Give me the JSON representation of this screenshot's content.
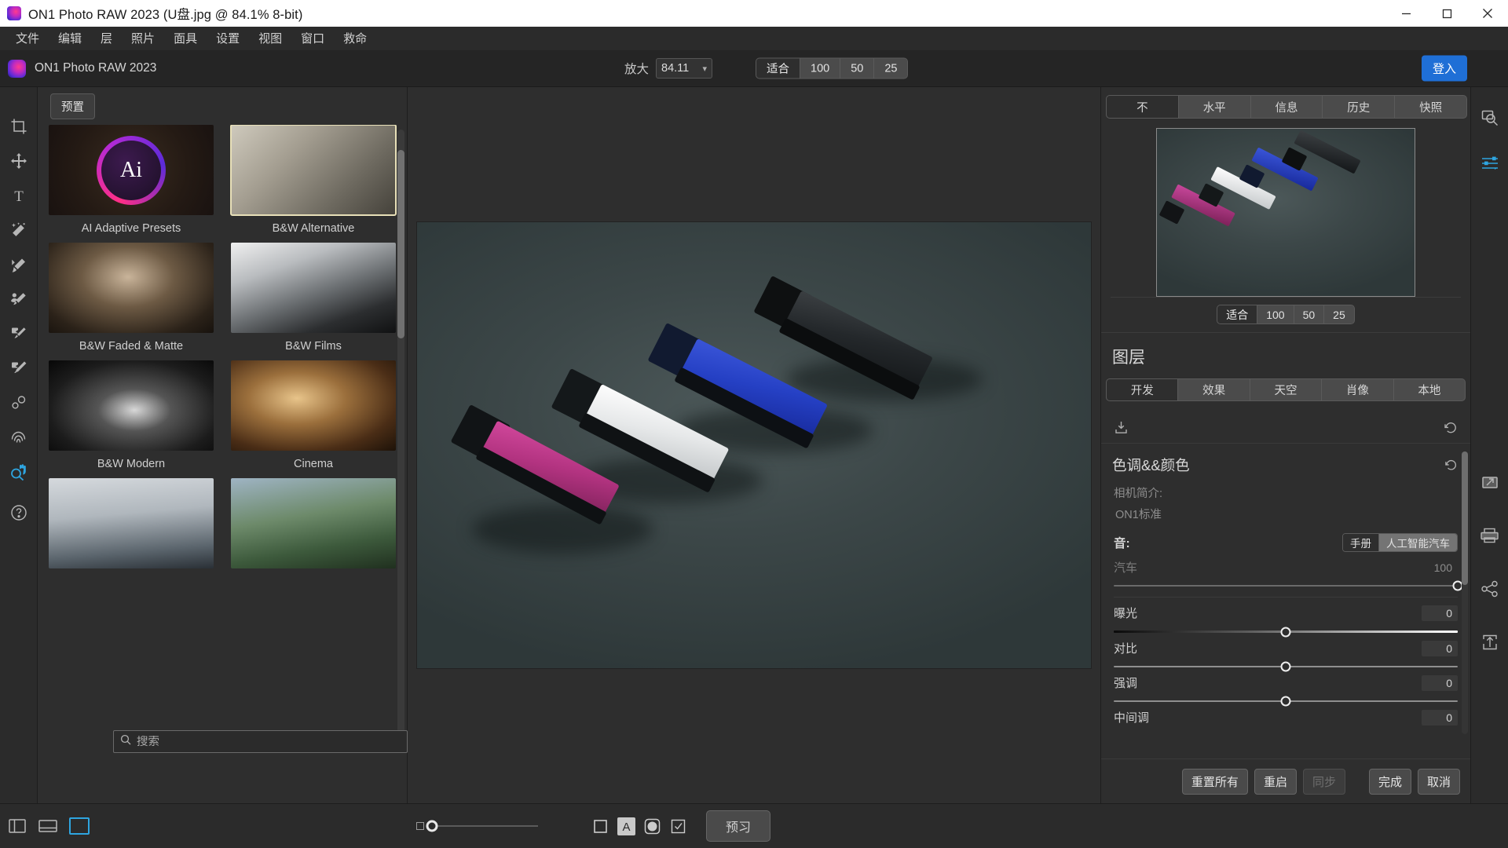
{
  "window": {
    "title": "ON1 Photo RAW 2023 (U盘.jpg @ 84.1% 8-bit)",
    "app_icon": "on1-logo-icon",
    "minimize_label": "minimize",
    "maximize_label": "maximize",
    "close_label": "close"
  },
  "menubar": {
    "items": [
      {
        "label": "文件"
      },
      {
        "label": "编辑"
      },
      {
        "label": "层"
      },
      {
        "label": "照片"
      },
      {
        "label": "面具"
      },
      {
        "label": "设置"
      },
      {
        "label": "视图"
      },
      {
        "label": "窗口"
      },
      {
        "label": "救命"
      }
    ]
  },
  "header": {
    "brand": "ON1 Photo RAW 2023",
    "zoom_label": "放大",
    "zoom_value": "84.11",
    "zoom_chevron": "chevron-down-icon",
    "fit_options": [
      {
        "label": "适合",
        "selected": true
      },
      {
        "label": "100",
        "selected": false
      },
      {
        "label": "50",
        "selected": false
      },
      {
        "label": "25",
        "selected": false
      }
    ],
    "login_label": "登入"
  },
  "tool_rail": {
    "tools": [
      {
        "name": "crop-tool",
        "active": false
      },
      {
        "name": "move-tool",
        "active": false
      },
      {
        "name": "text-tool",
        "active": false
      },
      {
        "name": "magic-wand-tool",
        "active": false
      },
      {
        "name": "retouch-brush-tool",
        "active": false
      },
      {
        "name": "portrait-brush-tool",
        "active": false
      },
      {
        "name": "perfect-eraser-tool",
        "active": false
      },
      {
        "name": "clone-stamp-tool",
        "active": false
      },
      {
        "name": "blemish-remover-tool",
        "active": false
      },
      {
        "name": "fingerprint-tool",
        "active": false
      },
      {
        "name": "zoom-hand-tool",
        "active": true
      },
      {
        "name": "help-tool",
        "active": false
      }
    ]
  },
  "presets": {
    "tab_label": "预置",
    "search_placeholder": "搜索",
    "search_value": "",
    "search_icon": "search-icon",
    "items": [
      {
        "label": "AI Adaptive Presets",
        "selected": false,
        "thumb": "ai-adaptive"
      },
      {
        "label": "B&W Alternative",
        "selected": true,
        "thumb": "bw-architecture"
      },
      {
        "label": "B&W Faded & Matte",
        "selected": false,
        "thumb": "bw-portrait"
      },
      {
        "label": "B&W Films",
        "selected": false,
        "thumb": "bw-bridge"
      },
      {
        "label": "B&W Modern",
        "selected": false,
        "thumb": "bw-waterfall"
      },
      {
        "label": "Cinema",
        "selected": false,
        "thumb": "cinema-woman"
      },
      {
        "label": "",
        "selected": false,
        "thumb": "still-life-scale"
      },
      {
        "label": "",
        "selected": false,
        "thumb": "landscape-woman"
      }
    ]
  },
  "canvas": {
    "image_name": "U盘.jpg",
    "image_alt": "四个 USB 闪存盘 (洋红、白、蓝、黑) 置于深灰绿色背景上"
  },
  "right_panel": {
    "tabs": [
      {
        "label": "不",
        "selected": true
      },
      {
        "label": "水平",
        "selected": false
      },
      {
        "label": "信息",
        "selected": false
      },
      {
        "label": "历史",
        "selected": false
      },
      {
        "label": "快照",
        "selected": false
      }
    ],
    "preview_fit_options": [
      {
        "label": "适合",
        "selected": true
      },
      {
        "label": "100",
        "selected": false
      },
      {
        "label": "50",
        "selected": false
      },
      {
        "label": "25",
        "selected": false
      }
    ],
    "layers_title": "图层",
    "layer_tabs": [
      {
        "label": "开发",
        "selected": true
      },
      {
        "label": "效果",
        "selected": false
      },
      {
        "label": "天空",
        "selected": false
      },
      {
        "label": "肖像",
        "selected": false
      },
      {
        "label": "本地",
        "selected": false
      }
    ],
    "toolstrip": {
      "preset_icon": "save-preset-icon",
      "reset_icon": "reset-arrow-icon"
    },
    "section": {
      "title": "色调&&颜色",
      "reset_icon": "reset-arrow-icon",
      "camera_profile_label": "相机简介:",
      "camera_profile_value": "ON1标准"
    },
    "tone": {
      "label": "音:",
      "modes": [
        {
          "label": "手册",
          "selected": true
        },
        {
          "label": "人工智能汽车",
          "selected": false
        }
      ]
    },
    "sliders": [
      {
        "name": "汽车",
        "value": "100",
        "position": 100,
        "dim": true,
        "gradient": false
      },
      {
        "name": "曝光",
        "value": "0",
        "position": 50,
        "dim": false,
        "gradient": true
      },
      {
        "name": "对比",
        "value": "0",
        "position": 50,
        "dim": false,
        "gradient": false
      },
      {
        "name": "强调",
        "value": "0",
        "position": 50,
        "dim": false,
        "gradient": false
      },
      {
        "name": "中间调",
        "value": "0",
        "position": 50,
        "dim": false,
        "gradient": false
      }
    ],
    "footer_buttons": [
      {
        "label": "重置所有",
        "disabled": false
      },
      {
        "label": "重启",
        "disabled": false
      },
      {
        "label": "同步",
        "disabled": true
      },
      {
        "label": "完成",
        "disabled": false
      },
      {
        "label": "取消",
        "disabled": false
      }
    ]
  },
  "icon_rail": {
    "icons": [
      {
        "name": "photo-search-icon",
        "accent": false
      },
      {
        "name": "adjustment-sliders-icon",
        "accent": true
      },
      {
        "name": "resize-export-icon",
        "accent": false
      },
      {
        "name": "print-icon",
        "accent": false
      },
      {
        "name": "share-icon",
        "accent": false
      },
      {
        "name": "export-upload-icon",
        "accent": false
      }
    ]
  },
  "bottom_bar": {
    "left_icons": [
      {
        "name": "toggle-left-panel-icon",
        "selected": false
      },
      {
        "name": "filmstrip-view-icon",
        "selected": false
      },
      {
        "name": "grid-view-icon",
        "selected": true
      }
    ],
    "thumb_size_icon": "small-square-icon",
    "thumb_size_value": 0,
    "view_icons": [
      {
        "name": "square-outline-icon",
        "filled": false
      },
      {
        "name": "letter-a-icon",
        "filled": true
      },
      {
        "name": "circle-mask-icon",
        "filled": false
      },
      {
        "name": "checkbox-icon",
        "filled": false
      }
    ],
    "preview_button": "预习"
  }
}
